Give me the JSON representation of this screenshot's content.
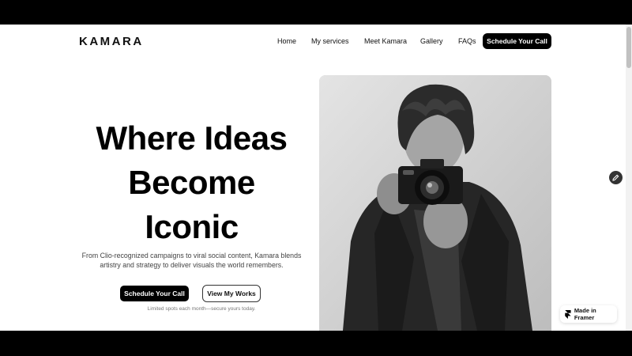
{
  "brand": {
    "logo": "KAMARA"
  },
  "nav": {
    "items": [
      {
        "label": "Home"
      },
      {
        "label": "My services"
      },
      {
        "label": "Meet Kamara"
      },
      {
        "label": "Gallery"
      },
      {
        "label": "FAQs"
      }
    ],
    "cta": "Schedule Your Call"
  },
  "hero": {
    "title_lines": [
      "Where Ideas",
      "Become",
      "Iconic"
    ],
    "description": "From Clio-recognized campaigns to viral social content, Kamara blends artistry and strategy to deliver visuals the world remembers.",
    "primary_button": "Schedule Your Call",
    "secondary_button": "View My Works",
    "note": "Limited spots each month—secure yours today."
  },
  "badge": {
    "label": "Made in Framer"
  },
  "icons": {
    "edit": "pencil-icon",
    "framer": "framer-logo-icon"
  },
  "colors": {
    "accent": "#000000",
    "background": "#ffffff"
  }
}
